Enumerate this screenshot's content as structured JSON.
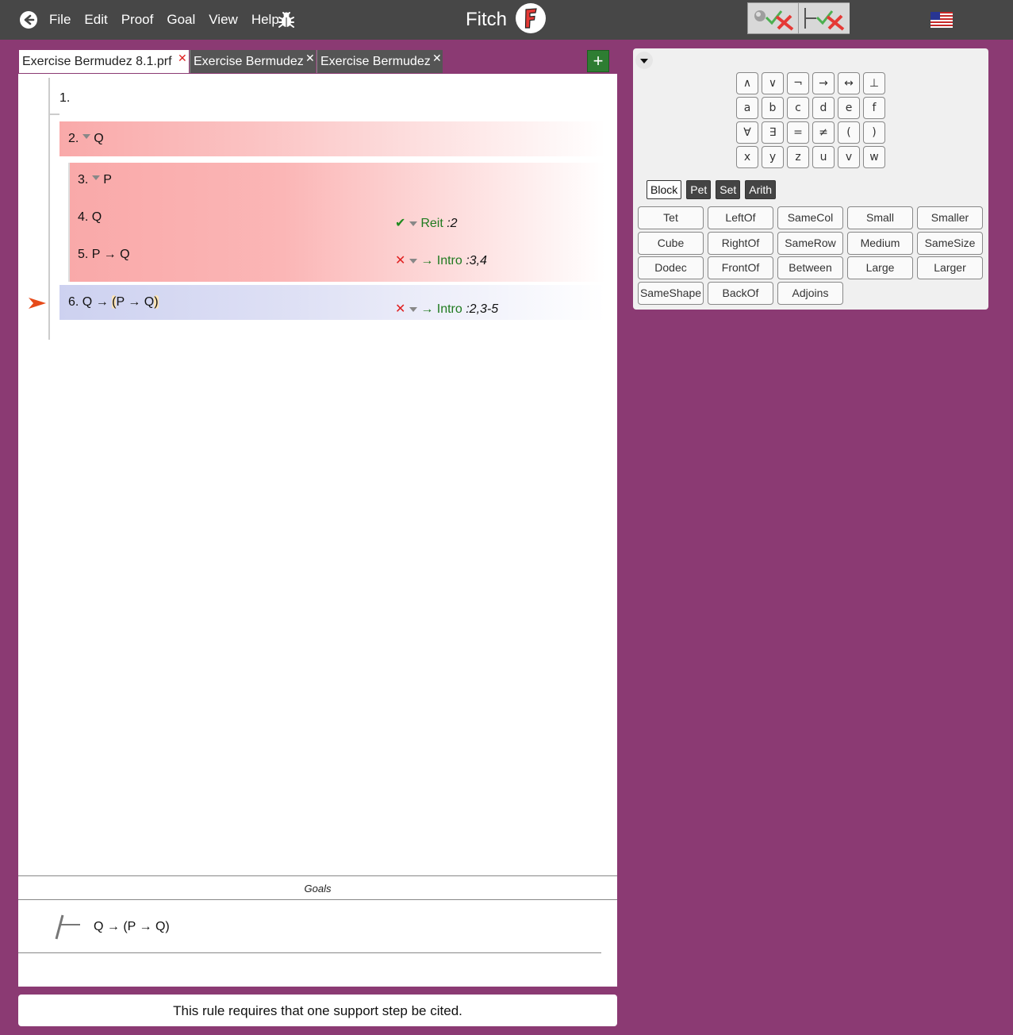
{
  "topbar": {
    "menu": [
      "File",
      "Edit",
      "Proof",
      "Goal",
      "View",
      "Help"
    ],
    "title": "Fitch",
    "logo_letter": "F"
  },
  "tabs": [
    {
      "label": "Exercise Bermudez 8.1.prf",
      "active": true
    },
    {
      "label": "Exercise Bermudez",
      "active": false
    },
    {
      "label": "Exercise Bermudez",
      "active": false
    }
  ],
  "add_tab_label": "+",
  "proof": {
    "lines": [
      {
        "num": "1.",
        "formula": ""
      },
      {
        "num": "2.",
        "formula": "Q"
      },
      {
        "num": "3.",
        "formula": "P"
      },
      {
        "num": "4.",
        "formula": "Q",
        "status": "✔",
        "rule": "Reit",
        "cite": ":2"
      },
      {
        "num": "5.",
        "formula": "P → Q",
        "status": "✕",
        "rule": "→ Intro",
        "cite": ":3,4"
      },
      {
        "num": "6.",
        "formula_pre": "Q → ",
        "paren_open": "(",
        "formula_mid": "P → Q",
        "paren_close": ")",
        "status": "✕",
        "rule": "→ Intro",
        "cite": ":2,3-5"
      }
    ]
  },
  "goals": {
    "header": "Goals",
    "items": [
      "Q → (P → Q)"
    ]
  },
  "status_message": "This rule requires that one support step be cited.",
  "keyboard": {
    "symbols": [
      "∧",
      "∨",
      "¬",
      "→",
      "↔",
      "⊥",
      "a",
      "b",
      "c",
      "d",
      "e",
      "f",
      "∀",
      "∃",
      "=",
      "≠",
      "(",
      ")",
      "x",
      "y",
      "z",
      "u",
      "v",
      "w"
    ],
    "languages": [
      {
        "label": "Block",
        "active": false
      },
      {
        "label": "Pet",
        "active": true
      },
      {
        "label": "Set",
        "active": true
      },
      {
        "label": "Arith",
        "active": true
      }
    ],
    "predicates": [
      "Tet",
      "LeftOf",
      "SameCol",
      "Small",
      "Smaller",
      "Cube",
      "RightOf",
      "SameRow",
      "Medium",
      "SameSize",
      "Dodec",
      "FrontOf",
      "Between",
      "Large",
      "Larger",
      "SameShape",
      "BackOf",
      "Adjoins"
    ]
  },
  "colors": {
    "background": "#8b3a73",
    "topbar": "#474747",
    "error_row": "#f9a9a9",
    "focus_row": "#cdd1f0",
    "rule_green": "#1f7a1f",
    "error_red": "#e02020"
  }
}
